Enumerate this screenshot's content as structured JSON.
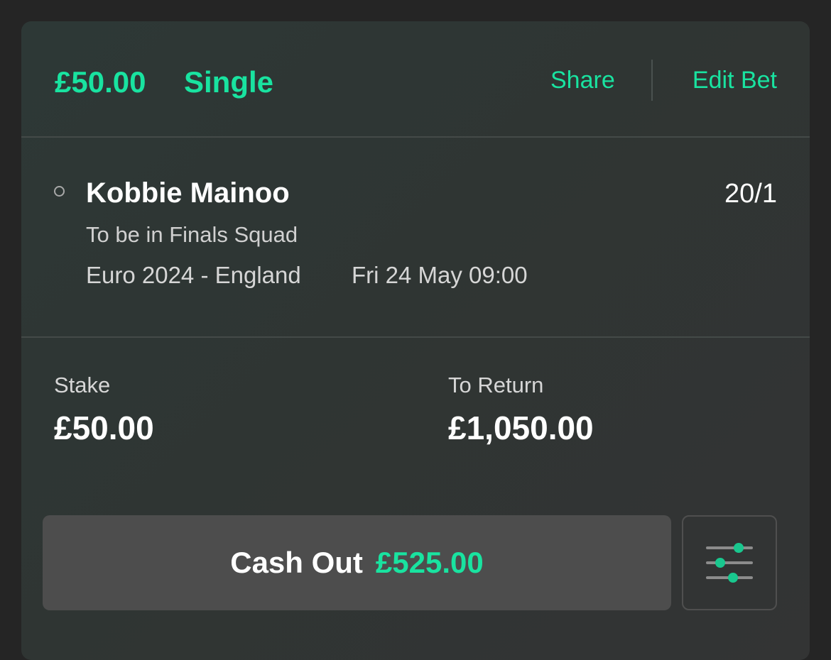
{
  "bet": {
    "amount": "£50.00",
    "type": "Single",
    "share_label": "Share",
    "edit_label": "Edit Bet"
  },
  "selection": {
    "name": "Kobbie Mainoo",
    "odds": "20/1",
    "market": "To be in Finals Squad",
    "event": "Euro 2024 - England",
    "date": "Fri 24 May 09:00"
  },
  "summary": {
    "stake_label": "Stake",
    "stake_value": "£50.00",
    "return_label": "To Return",
    "return_value": "£1,050.00"
  },
  "cashout": {
    "label": "Cash Out",
    "value": "£525.00"
  },
  "icons": {
    "status": "status-circle-icon",
    "settings": "sliders-icon"
  },
  "colors": {
    "accent": "#19e3a0",
    "background": "#252525",
    "card": "#2f3533",
    "button": "#4d4d4d"
  }
}
